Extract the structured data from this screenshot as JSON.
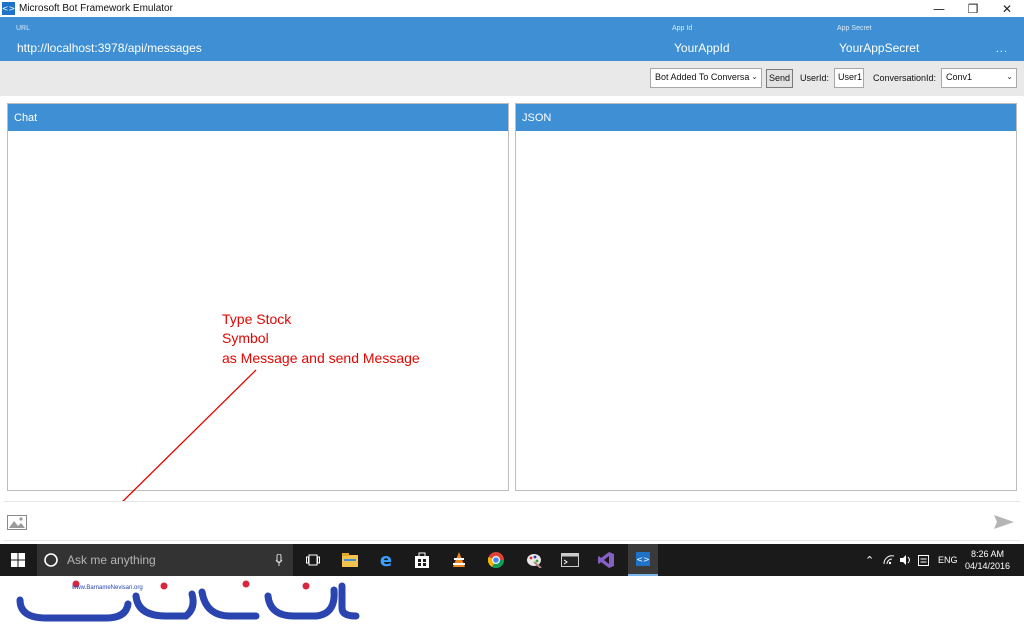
{
  "window": {
    "title": "Microsoft Bot Framework Emulator",
    "minimize": "—",
    "restore": "❐",
    "close": "✕"
  },
  "header": {
    "url_label": "URL",
    "url_value": "http://localhost:3978/api/messages",
    "appid_label": "App Id",
    "appid_value": "YourAppId",
    "appsecret_label": "App Secret",
    "appsecret_value": "YourAppSecret",
    "more": "..."
  },
  "toolbar": {
    "activity_select": "Bot Added To Conversa",
    "send_label": "Send",
    "userid_label": "UserId:",
    "userid_value": "User1",
    "conversationid_label": "ConversationId:",
    "conversationid_value": "Conv1"
  },
  "panels": {
    "chat_title": "Chat",
    "json_title": "JSON"
  },
  "annotation": {
    "line1": "Type Stock",
    "line2": "Symbol",
    "line3": "as Message and send Message",
    "color": "#e10600"
  },
  "taskbar": {
    "search_placeholder": "Ask me anything",
    "language": "ENG",
    "time": "8:26 AM",
    "date": "04/14/2016",
    "apps": [
      "task-view-icon",
      "file-explorer-icon",
      "edge-icon",
      "store-icon",
      "vlc-icon",
      "chrome-icon",
      "paint-icon",
      "cmd-icon",
      "visual-studio-icon",
      "emulator-icon"
    ]
  },
  "watermark": {
    "site": "www.BarnameNevisan.org"
  },
  "colors": {
    "accent_blue": "#3e8fd3",
    "taskbar": "#1a1a1a"
  }
}
